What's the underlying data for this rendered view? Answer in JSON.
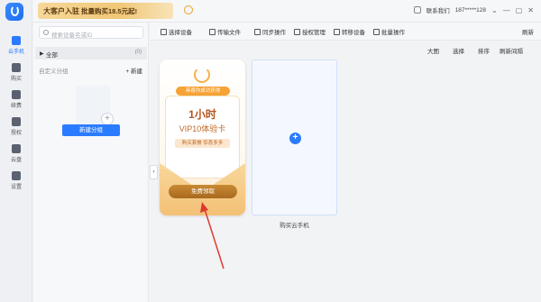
{
  "topbar": {
    "banner_title": "大客户入驻",
    "banner_text": "批量购买18.5元起!",
    "support": "联系我们",
    "account": "187*****128"
  },
  "rail": {
    "items": [
      {
        "label": "云手机",
        "icon": "phone-icon",
        "active": true
      },
      {
        "label": "购买",
        "icon": "cart-icon"
      },
      {
        "label": "续费",
        "icon": "renew-icon"
      },
      {
        "label": "授权",
        "icon": "auth-icon"
      },
      {
        "label": "云盘",
        "icon": "cloud-disk-icon"
      },
      {
        "label": "设置",
        "icon": "gear-icon"
      }
    ]
  },
  "panel": {
    "search_placeholder": "搜索设备名或ID",
    "group_all": "全部",
    "group_count": "(0)",
    "custom_group": "自定义分组",
    "new_link": "+ 新建",
    "new_group_button": "新建分组"
  },
  "toolbar": {
    "items": [
      "选择设备",
      "传输文件",
      "同步操作",
      "授权管理",
      "转移设备",
      "批量操作"
    ],
    "refresh": "刷新"
  },
  "viewbar": {
    "items": [
      "大图",
      "选择",
      "排序",
      "刷新间隔"
    ]
  },
  "card": {
    "ribbon": "恭喜你成功获得",
    "hours": "1小时",
    "vip": "VIP10体验卡",
    "tag": "购买套餐 惊喜多多",
    "claim_button": "免费领取"
  },
  "buy": {
    "label": "购买云手机"
  },
  "colors": {
    "accent": "#2b7bff",
    "gold": "#a8691f"
  }
}
